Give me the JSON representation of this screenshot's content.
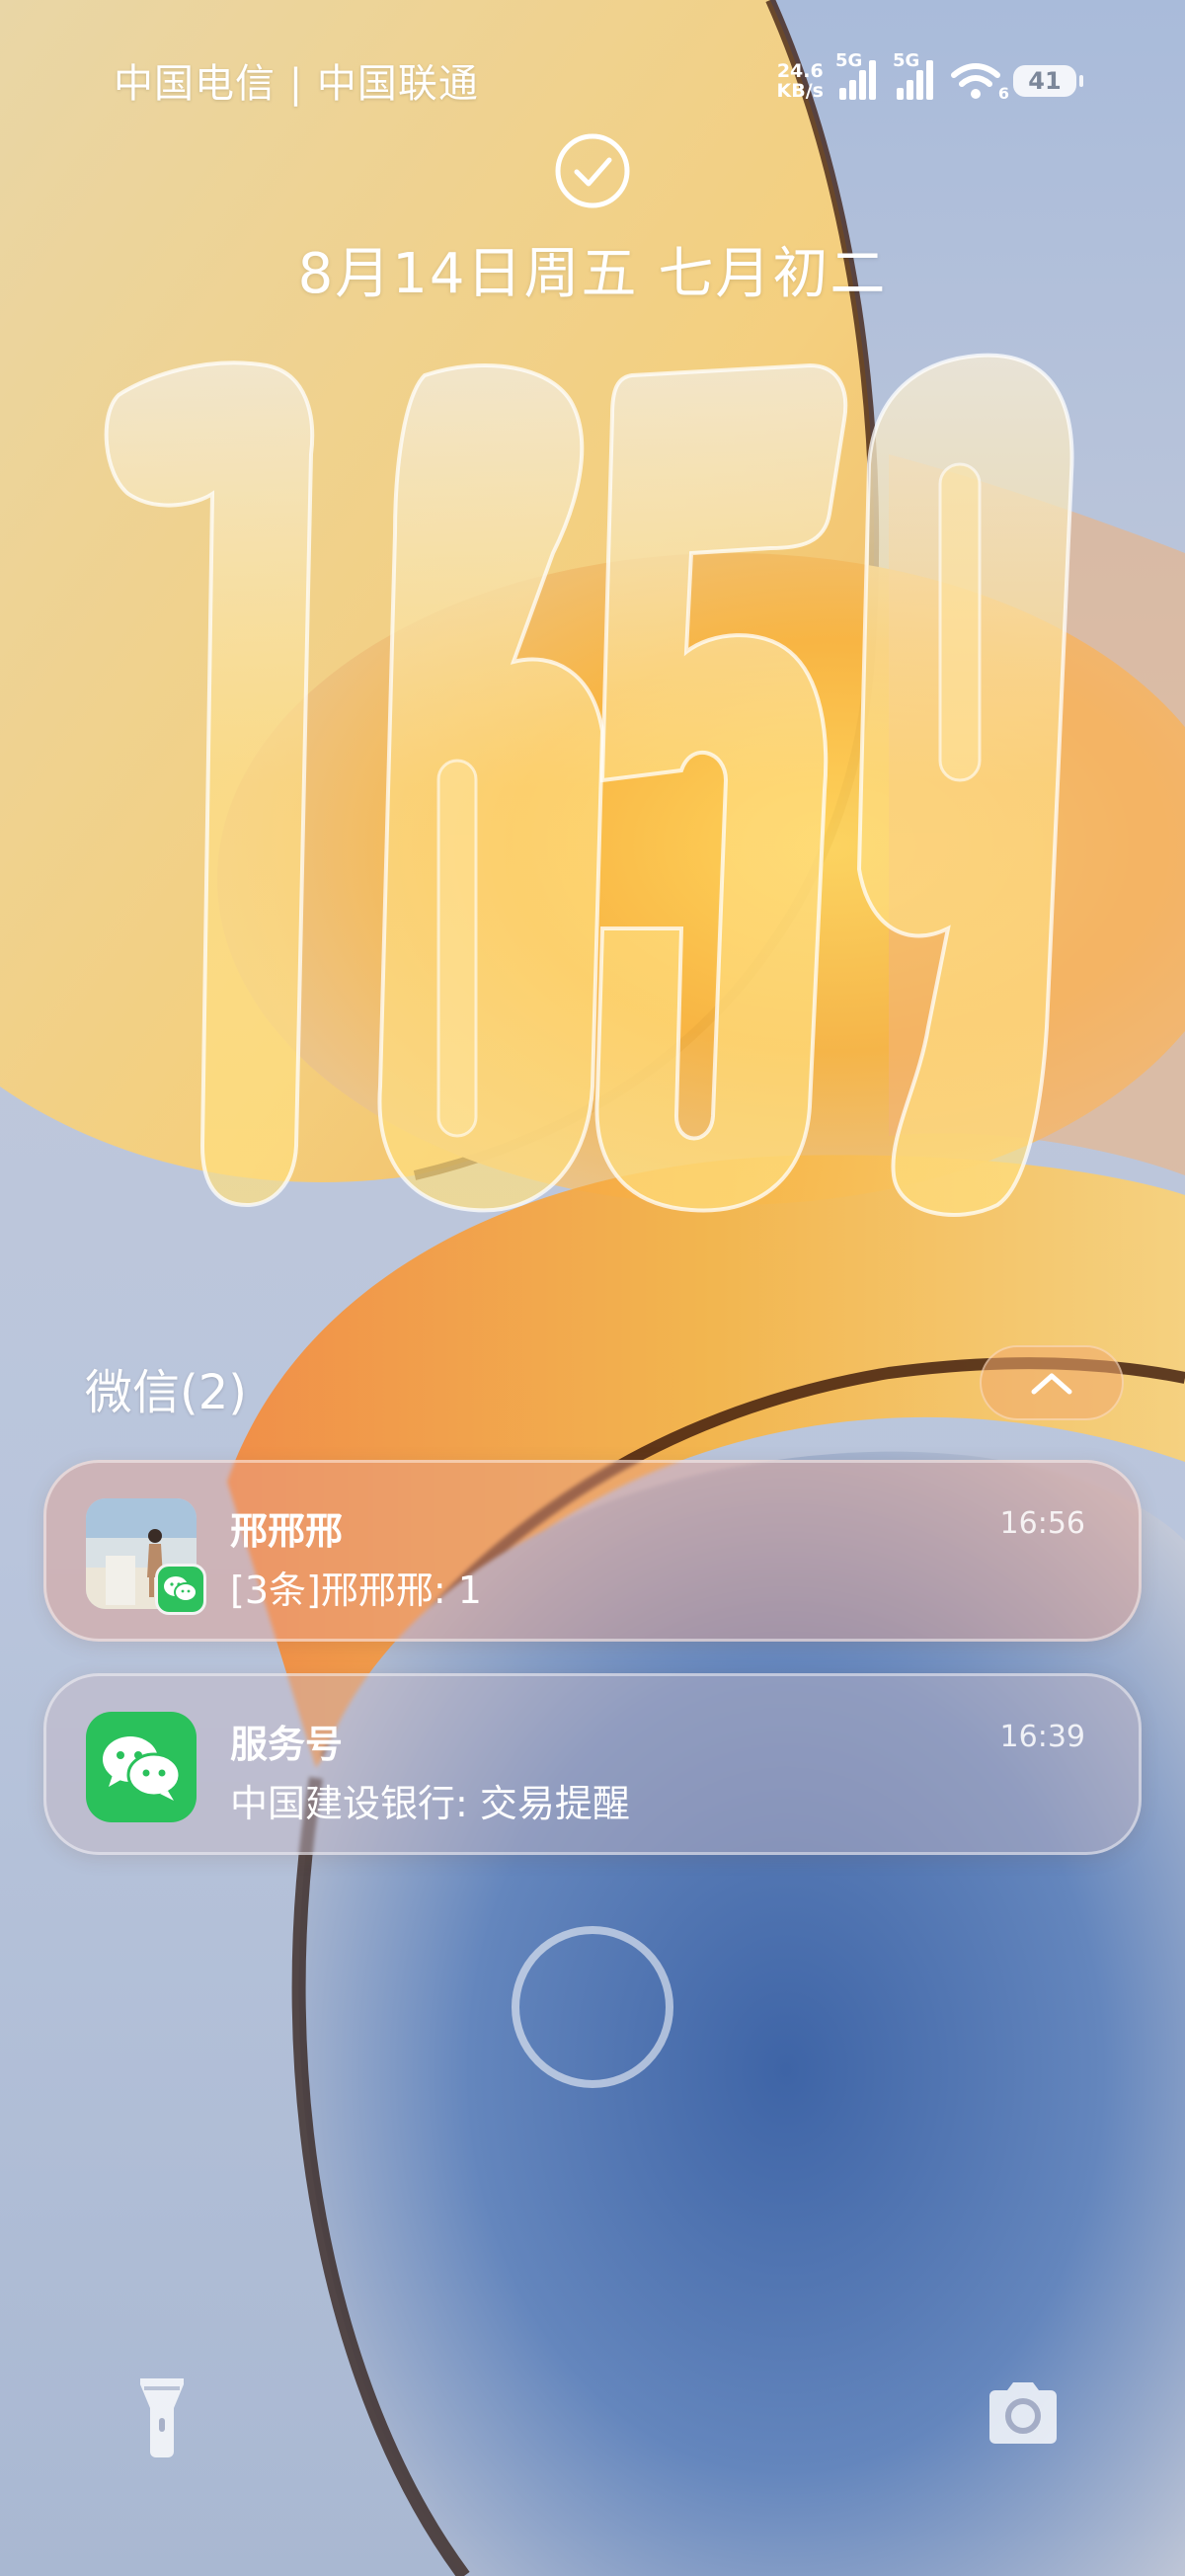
{
  "status_bar": {
    "carrier": "中国电信 | 中国联通",
    "net_speed_value": "24.6",
    "net_speed_unit": "KB/s",
    "signal_1_label": "5G",
    "signal_2_label": "5G",
    "wifi_label": "6",
    "battery_level": "41"
  },
  "lock_icon": "checkmark-circle-icon",
  "date_text": "8月14日周五 七月初二",
  "clock": {
    "digits": [
      "1",
      "6",
      "5",
      "9"
    ]
  },
  "notifications": {
    "group_title": "微信(2)",
    "collapse_icon": "chevron-up-icon",
    "items": [
      {
        "sender": "邢邢邢",
        "body": "[3条]邢邢邢: 1",
        "time": "16:56",
        "icon": "contact-avatar-with-wechat-badge"
      },
      {
        "sender": "服务号",
        "body": "中国建设银行: 交易提醒",
        "time": "16:39",
        "icon": "wechat-icon"
      }
    ]
  },
  "bottom": {
    "left_icon": "flashlight-icon",
    "right_icon": "camera-icon",
    "center": "home-ring"
  },
  "colors": {
    "wechat_green": "#2ac15b",
    "wallpaper_orange": "#f5a63b",
    "wallpaper_blue": "#3e5a8c"
  }
}
